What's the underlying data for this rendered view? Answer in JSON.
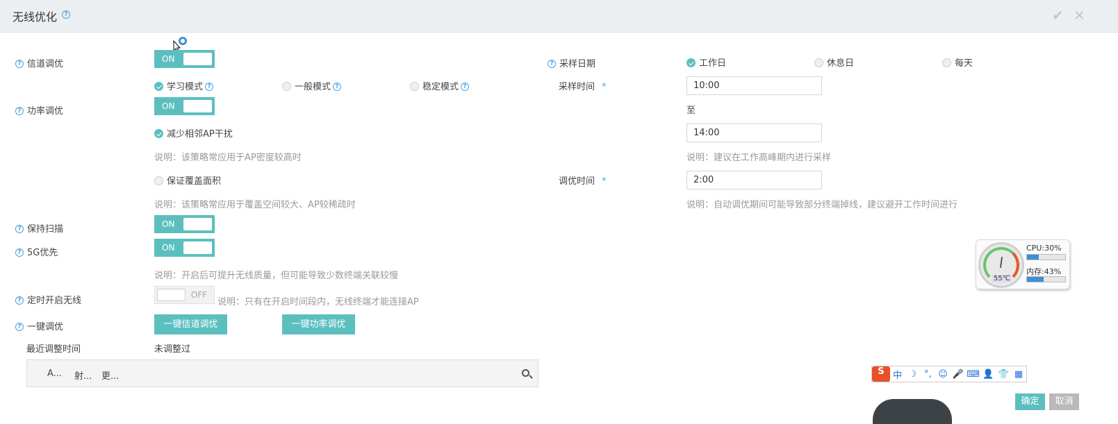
{
  "header": {
    "title": "无线优化",
    "help": "?",
    "confirm_icon": "check-icon",
    "close_icon": "close-icon"
  },
  "rows": {
    "channel": {
      "label": "信道调优",
      "toggle": "ON"
    },
    "modes": [
      {
        "label": "学习模式",
        "selected": true
      },
      {
        "label": "一般模式",
        "selected": false
      },
      {
        "label": "稳定模式",
        "selected": false
      }
    ],
    "power": {
      "label": "功率调优",
      "toggle": "ON"
    },
    "reduce_interference": {
      "label": "减少相邻AP干扰",
      "note": "说明：该策略常应用于AP密度较高时"
    },
    "ensure_coverage": {
      "label": "保证覆盖面积",
      "note": "说明：该策略常应用于覆盖空间较大、AP较稀疏时"
    },
    "keep_scan": {
      "label": "保持扫描",
      "toggle": "ON"
    },
    "prefer_5g": {
      "label": "5G优先",
      "toggle": "ON",
      "note": "说明：开启后可提升无线质量，但可能导致少数终端关联较慢"
    },
    "scheduled_wireless": {
      "label": "定时开启无线",
      "toggle": "OFF",
      "note": "说明：只有在开启时间段内，无线终端才能连接AP"
    },
    "one_click": {
      "label": "一键调优",
      "channel_btn": "一键信道调优",
      "power_btn": "一键功率调优"
    },
    "last_adjust": {
      "label": "最近调整时间",
      "value": "未调整过"
    }
  },
  "sampling": {
    "date_label": "采样日期",
    "dates": [
      {
        "label": "工作日",
        "selected": true
      },
      {
        "label": "休息日",
        "selected": false
      },
      {
        "label": "每天",
        "selected": false
      }
    ],
    "time_label": "采样时间",
    "required": "*",
    "start": "10:00",
    "to": "至",
    "end": "14:00",
    "note": "说明：建议在工作高峰期内进行采样",
    "tune_label": "调优时间",
    "tune_time": "2:00",
    "tune_note": "说明：自动调优期间可能导致部分终端掉线，建议避开工作时间进行"
  },
  "table": {
    "columns": [
      "A...",
      "射...",
      "更..."
    ]
  },
  "monitor": {
    "cpu": "CPU:30%",
    "cpu_pct": 30,
    "mem": "内存:43%",
    "mem_pct": 43,
    "temp": "55℃"
  },
  "ime": {
    "logo": "S",
    "items": [
      "中",
      "☽",
      "°,",
      "☺",
      "🎤",
      "⌨",
      "👤",
      "👕",
      "▦"
    ]
  },
  "footer": {
    "ok": "确定",
    "cancel": "取消"
  },
  "colors": {
    "accent": "#5cbfbf",
    "help": "#4aa3df",
    "header_bg": "#eceff1"
  }
}
